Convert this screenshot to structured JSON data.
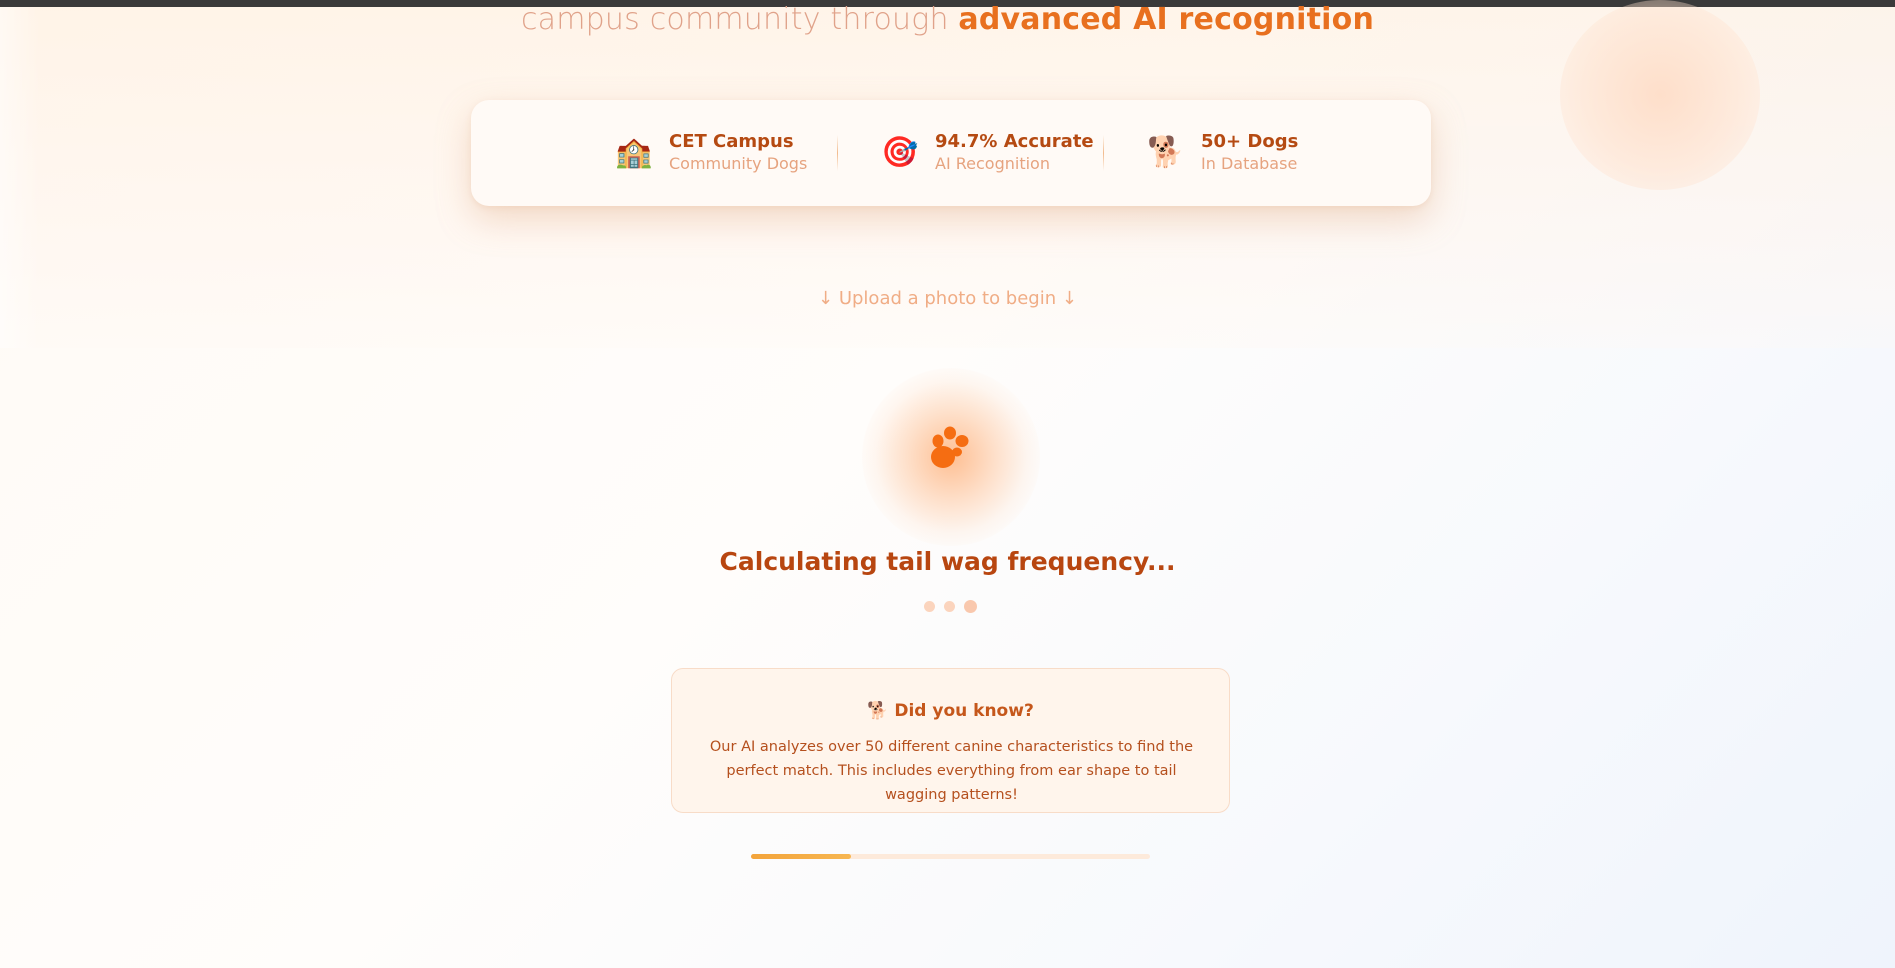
{
  "hero": {
    "subtitle_plain": "campus community through",
    "subtitle_strong": "advanced AI recognition"
  },
  "stats": [
    {
      "icon": "school-icon",
      "emoji": "🏫",
      "title": "CET Campus",
      "subtitle": "Community Dogs"
    },
    {
      "icon": "target-icon",
      "emoji": "🎯",
      "title": "94.7% Accurate",
      "subtitle": "AI Recognition"
    },
    {
      "icon": "dog-icon",
      "emoji": "🐕",
      "title": "50+ Dogs",
      "subtitle": "In Database"
    }
  ],
  "upload_hint": "↓ Upload a photo to begin ↓",
  "loading": {
    "icon": "paw-icon",
    "message": "Calculating tail wag frequency...",
    "progress_fraction": 0.25
  },
  "fact": {
    "icon": "dog-icon",
    "emoji": "🐕",
    "title": "Did you know?",
    "body": "Our AI analyzes over 50 different canine characteristics to find the perfect match. This includes everything from ear shape to tail wagging patterns!"
  },
  "colors": {
    "accent": "#e8701f",
    "accent_dark": "#b84610",
    "progress": "#f3a43b"
  }
}
